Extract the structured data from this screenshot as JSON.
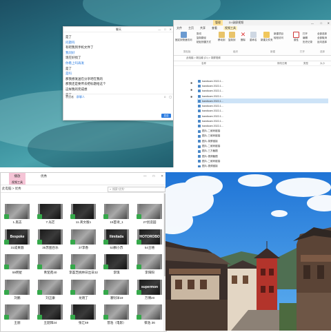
{
  "colors": {
    "accent_pink": "#f5c4d6",
    "thumb_badge_green": "#35a84a",
    "selection_blue": "#cde3f7"
  },
  "chat": {
    "title": "聊天",
    "window_controls": [
      "—",
      "□",
      "✕"
    ],
    "messages": [
      {
        "text": "是了",
        "from": "me"
      },
      {
        "text": "问题吗",
        "from": "peer"
      },
      {
        "text": "有吧我到手机文件了",
        "from": "me"
      },
      {
        "text": "我问好",
        "from": "peer"
      },
      {
        "text": "现在好找了",
        "from": "me"
      },
      {
        "text": "你看上吗再发",
        "from": "peer"
      },
      {
        "text": "是了",
        "from": "me"
      },
      {
        "text": "是吗",
        "from": "peer"
      },
      {
        "text": "那我想发送在分享吧在我的",
        "from": "me"
      },
      {
        "text": "那我还是要传去把标题给这个",
        "from": "me"
      },
      {
        "text": "这样我的完成想",
        "from": "me"
      },
      {
        "text": "是了",
        "from": "me"
      }
    ],
    "toolbar_left": "发送者",
    "toolbar_mid": "群聊人",
    "send_label": "发送"
  },
  "explorer_top": {
    "manage_tab": "管理",
    "title": "D:\\录屏视频",
    "window_controls": [
      "—",
      "□",
      "✕"
    ],
    "tabs": [
      "文件",
      "主页",
      "共享",
      "查看",
      "视频工具"
    ],
    "ribbon": {
      "pin": "固定到快速访问",
      "copy": "复制",
      "paste": "粘贴",
      "cut": "剪切",
      "copy_path": "复制路径",
      "paste_shortcut": "粘贴快捷方式",
      "move_to": "移动到",
      "copy_to": "复制到",
      "delete": "删除",
      "rename": "重命名",
      "new_folder": "新建文件夹",
      "new_item": "新建项目",
      "easy_access": "轻松访问",
      "properties": "属性",
      "open": "打开",
      "edit": "编辑",
      "history": "历史记录",
      "select_all": "全部选择",
      "select_none": "全部取消",
      "invert": "反向选择",
      "group_clipboard": "剪贴板",
      "group_organize": "组织",
      "group_new": "新建",
      "group_open": "打开",
      "group_select": "选择"
    },
    "address": "此电脑 > 新加卷 (D:) > 录屏视频",
    "columns": [
      "名称",
      "修改日期",
      "类型",
      "大小"
    ],
    "files": [
      "bandicam 2022-1...",
      "bandicam 2022-1...",
      "bandicam 2022-1...",
      "bandicam 2022-1...",
      "bandicam 2022-1...",
      "bandicam 2022-1...",
      "bandicam 2022-1...",
      "bandicam 2022-1...",
      "bandicam 2022-1...",
      "bandicam 2022-1...",
      "图片-二维码链接",
      "图片-三维码链接",
      "图片-录屏链接",
      "图片-二维码链接",
      "图片-三方截图",
      "图片-视频截图",
      "图片-二维码链接",
      "图片-视频链接"
    ],
    "selected_index": 4
  },
  "explorer_bottom": {
    "manage_tab": "播放",
    "title": "优秀",
    "sub_tab": "视频工具",
    "window_controls": [
      "—",
      "□",
      "✕"
    ],
    "path": "此电脑 > 优秀",
    "search_placeholder": "搜索\"优秀\"",
    "videos": [
      {
        "label": "1.黑志",
        "theme": "gray"
      },
      {
        "label": "7.光芒",
        "theme": "dark"
      },
      {
        "label": "11.英文版1",
        "theme": "dark"
      },
      {
        "label": "15首诗_1",
        "theme": "gray"
      },
      {
        "label": "27创造园",
        "theme": "gray"
      },
      {
        "label": "31成果圆",
        "theme": "dark",
        "text": "Bespoke"
      },
      {
        "label": "35苏图合乐",
        "theme": "dark"
      },
      {
        "label": "37李香",
        "theme": "gray"
      },
      {
        "label": "53狮小苏",
        "theme": "dark",
        "text": "Ilimitada"
      },
      {
        "label": "54王嘻",
        "theme": "dark",
        "text": "PHOTOROBOT"
      },
      {
        "label": "59明星",
        "theme": "gray"
      },
      {
        "label": "青茄苑40",
        "theme": "gray"
      },
      {
        "label": "李荟芝桃林日出日32",
        "theme": "gray"
      },
      {
        "label": "李琪",
        "theme": "dark"
      },
      {
        "label": "李阳阳",
        "theme": "gray"
      },
      {
        "label": "刘鹏",
        "theme": "gray"
      },
      {
        "label": "刘正康",
        "theme": "gray"
      },
      {
        "label": "龙晓丁",
        "theme": "gray"
      },
      {
        "label": "潘钊洋19",
        "theme": "gray"
      },
      {
        "label": "万傅20",
        "theme": "dark",
        "text": "supermon"
      },
      {
        "label": "王丽",
        "theme": "gray"
      },
      {
        "label": "王韶阳24",
        "theme": "dark"
      },
      {
        "label": "张汇59",
        "theme": "dark"
      },
      {
        "label": "曾浩（电影）",
        "theme": "gray"
      },
      {
        "label": "蔡浩 36",
        "theme": "gray"
      }
    ]
  },
  "photo": {
    "subject": "古镇建筑 蓝天白云"
  }
}
